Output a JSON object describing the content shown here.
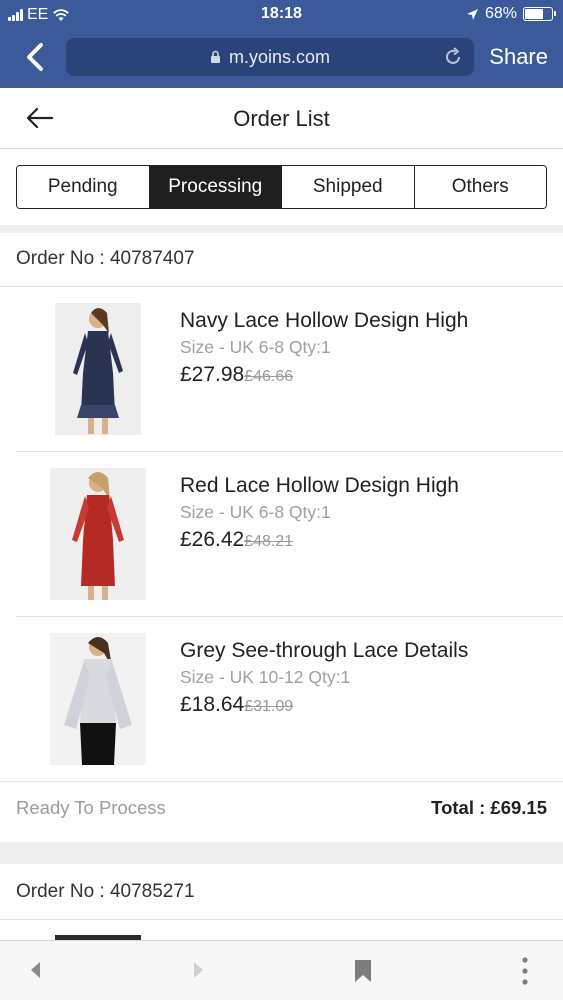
{
  "status_bar": {
    "carrier": "EE",
    "time": "18:18",
    "battery_percent": "68%",
    "battery_level": 0.68
  },
  "browser": {
    "url": "m.yoins.com",
    "share_label": "Share"
  },
  "page": {
    "title": "Order List"
  },
  "tabs": [
    {
      "label": "Pending",
      "active": false
    },
    {
      "label": "Processing",
      "active": true
    },
    {
      "label": "Shipped",
      "active": false
    },
    {
      "label": "Others",
      "active": false
    }
  ],
  "orders": [
    {
      "order_no": "Order No : 40787407",
      "status": "Ready To Process",
      "total": "Total : £69.15",
      "items": [
        {
          "name": "Navy Lace Hollow Design High",
          "meta": "Size - UK 6-8  Qty:1",
          "price": "£27.98",
          "original_price": "£46.66",
          "image": "navy-dress-image"
        },
        {
          "name": "Red Lace Hollow Design High",
          "meta": "Size - UK 6-8  Qty:1",
          "price": "£26.42",
          "original_price": "£48.21",
          "image": "red-dress-image"
        },
        {
          "name": "Grey See-through Lace Details",
          "meta": "Size - UK 10-12  Qty:1",
          "price": "£18.64",
          "original_price": "£31.09",
          "image": "grey-top-image"
        }
      ]
    },
    {
      "order_no": "Order No : 40785271"
    }
  ],
  "colors": {
    "safari_blue": "#3c5a99",
    "url_bar": "#2a4378",
    "active_tab": "#1f1f1f",
    "muted_text": "#a0a0a0",
    "navy_dress": "#2b3352",
    "red_dress": "#b62a26",
    "grey_top": "#d8dadf"
  },
  "bottom_bar": {
    "icons": [
      "back-arrow-icon",
      "forward-arrow-icon",
      "bookmark-icon",
      "more-vertical-icon"
    ]
  }
}
